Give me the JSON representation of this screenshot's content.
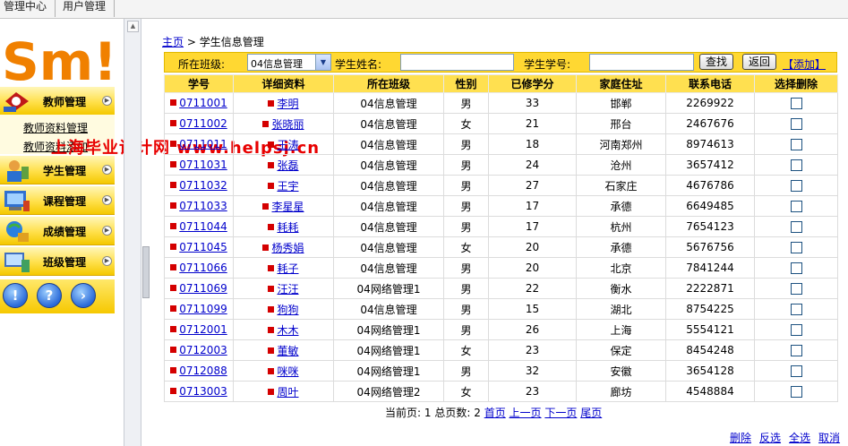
{
  "top_tabs": [
    "管理中心",
    "用户管理"
  ],
  "sidebar": {
    "menus": [
      {
        "label": "教师管理",
        "icon": "teacher-icon"
      },
      {
        "label": "学生管理",
        "icon": "student-icon"
      },
      {
        "label": "课程管理",
        "icon": "course-icon"
      },
      {
        "label": "成绩管理",
        "icon": "grade-icon"
      },
      {
        "label": "班级管理",
        "icon": "class-icon"
      }
    ],
    "submenu": [
      "教师资料管理",
      "教师资料添加"
    ],
    "bottom_icons": [
      "alert-icon",
      "help-icon",
      "next-icon"
    ],
    "logo_text": "Sm!"
  },
  "breadcrumb": {
    "home": "主页",
    "current": "学生信息管理"
  },
  "search": {
    "class_label": "所在班级:",
    "class_value": "04信息管理",
    "name_label": "学生姓名:",
    "name_value": "",
    "id_label": "学生学号:",
    "id_value": "",
    "find_btn": "查找",
    "back_btn": "返回",
    "add_link": "【添加】"
  },
  "table": {
    "headers": [
      "学号",
      "详细资料",
      "所在班级",
      "性别",
      "已修学分",
      "家庭住址",
      "联系电话",
      "选择删除"
    ],
    "rows": [
      [
        "0711001",
        "李明",
        "04信息管理",
        "男",
        "33",
        "邯郸",
        "2269922"
      ],
      [
        "0711002",
        "张晓丽",
        "04信息管理",
        "女",
        "21",
        "邢台",
        "2467676"
      ],
      [
        "0711011",
        "王涛",
        "04信息管理",
        "男",
        "18",
        "河南郑州",
        "8974613"
      ],
      [
        "0711031",
        "张磊",
        "04信息管理",
        "男",
        "24",
        "沧州",
        "3657412"
      ],
      [
        "0711032",
        "王宇",
        "04信息管理",
        "男",
        "27",
        "石家庄",
        "4676786"
      ],
      [
        "0711033",
        "李星星",
        "04信息管理",
        "男",
        "17",
        "承德",
        "6649485"
      ],
      [
        "0711044",
        "耗耗",
        "04信息管理",
        "男",
        "17",
        "杭州",
        "7654123"
      ],
      [
        "0711045",
        "杨秀娟",
        "04信息管理",
        "女",
        "20",
        "承德",
        "5676756"
      ],
      [
        "0711066",
        "耗子",
        "04信息管理",
        "男",
        "20",
        "北京",
        "7841244"
      ],
      [
        "0711069",
        "汪汪",
        "04网络管理1",
        "男",
        "22",
        "衡水",
        "2222871"
      ],
      [
        "0711099",
        "狗狗",
        "04信息管理",
        "男",
        "15",
        "湖北",
        "8754225"
      ],
      [
        "0712001",
        "木木",
        "04网络管理1",
        "男",
        "26",
        "上海",
        "5554121"
      ],
      [
        "0712003",
        "董敏",
        "04网络管理1",
        "女",
        "23",
        "保定",
        "8454248"
      ],
      [
        "0712088",
        "咪咪",
        "04网络管理1",
        "男",
        "32",
        "安徽",
        "3654128"
      ],
      [
        "0713003",
        "周叶",
        "04网络管理2",
        "女",
        "23",
        "廊坊",
        "4548884"
      ]
    ]
  },
  "pager": {
    "current_label": "当前页:",
    "current": "1",
    "total_label": "总页数:",
    "total": "2",
    "first": "首页",
    "prev": "上一页",
    "next": "下一页",
    "last": "尾页"
  },
  "footer_actions": [
    "删除",
    "反选",
    "全选",
    "取消"
  ],
  "watermark": "上海毕业设计网 www.helpsj.cn",
  "colors": {
    "header_yellow": "#ffe050",
    "link_blue": "#0000cc",
    "mark_red": "#d40000"
  }
}
